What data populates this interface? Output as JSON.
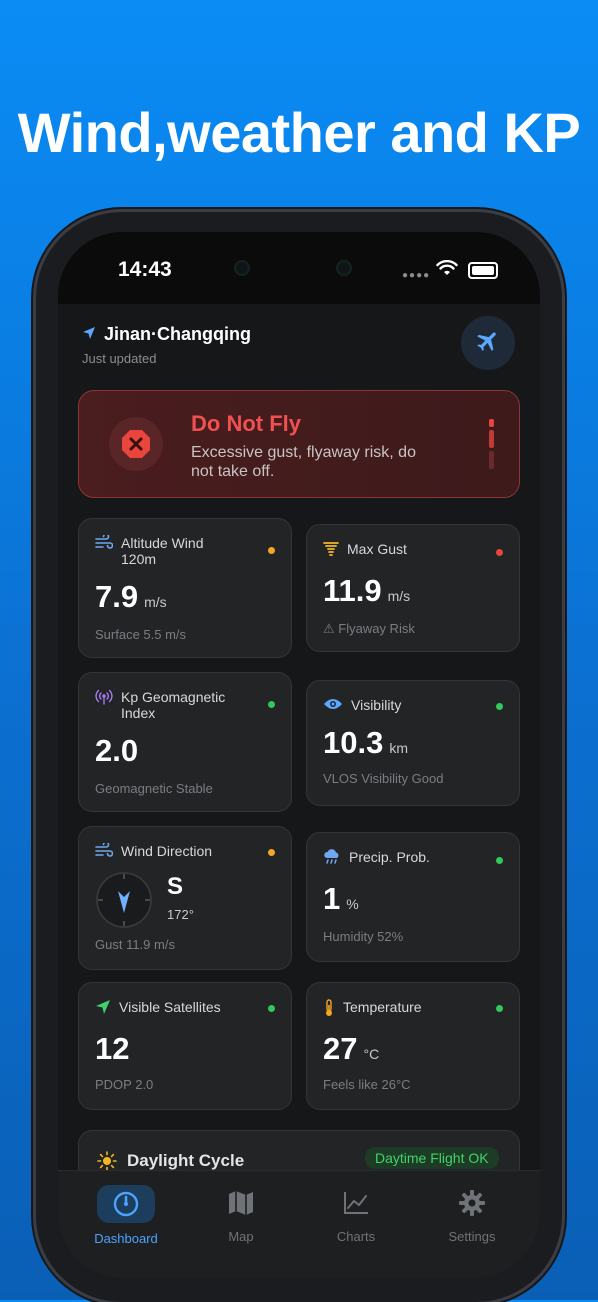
{
  "headline": "Wind,weather and KP",
  "status": {
    "time": "14:43"
  },
  "location": {
    "name": "Jinan·Changqing",
    "updated": "Just updated"
  },
  "alert": {
    "title": "Do Not Fly",
    "message": "Excessive gust, flyaway risk, do not take off.",
    "color": "#f0504f"
  },
  "cards": {
    "altitude_wind": {
      "label": "Altitude Wind 120m",
      "value": "7.9",
      "unit": "m/s",
      "sub": "Surface 5.5 m/s",
      "status_color": "#f5a623",
      "icon": "wind-icon"
    },
    "max_gust": {
      "label": "Max Gust",
      "value": "11.9",
      "unit": "m/s",
      "sub": "⚠ Flyaway Risk",
      "status_color": "#e8453c",
      "icon": "tornado-icon"
    },
    "kp_index": {
      "label": "Kp Geomagnetic Index",
      "value": "2.0",
      "unit": "",
      "sub": "Geomagnetic Stable",
      "status_color": "#34c759",
      "icon": "antenna-icon"
    },
    "visibility": {
      "label": "Visibility",
      "value": "10.3",
      "unit": "km",
      "sub": "VLOS Visibility Good",
      "status_color": "#34c759",
      "icon": "eye-icon"
    },
    "wind_direction": {
      "label": "Wind Direction",
      "direction": "S",
      "degrees": "172°",
      "sub": "Gust 11.9 m/s",
      "status_color": "#f5a623",
      "icon": "wind-icon"
    },
    "precip": {
      "label": "Precip. Prob.",
      "value": "1",
      "unit": "%",
      "sub": "Humidity 52%",
      "status_color": "#34c759",
      "icon": "cloud-rain-icon"
    },
    "satellites": {
      "label": "Visible Satellites",
      "value": "12",
      "unit": "",
      "sub": "PDOP 2.0",
      "status_color": "#34c759",
      "icon": "location-arrow-icon"
    },
    "temperature": {
      "label": "Temperature",
      "value": "27",
      "unit": "°C",
      "sub": "Feels like 26°C",
      "status_color": "#34c759",
      "icon": "thermometer-icon"
    }
  },
  "daylight": {
    "title": "Daylight Cycle",
    "badge": "Daytime Flight OK"
  },
  "tabs": [
    {
      "label": "Dashboard",
      "icon": "gauge-icon",
      "active": true
    },
    {
      "label": "Map",
      "icon": "map-icon",
      "active": false
    },
    {
      "label": "Charts",
      "icon": "chart-icon",
      "active": false
    },
    {
      "label": "Settings",
      "icon": "gear-icon",
      "active": false
    }
  ]
}
